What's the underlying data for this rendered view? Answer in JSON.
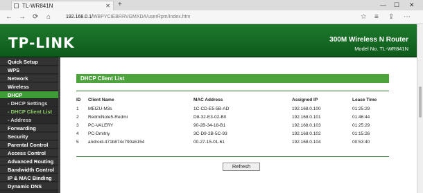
{
  "browser": {
    "tab_title": "TL-WR841N",
    "close_glyph": "✕",
    "newtab_glyph": "+",
    "url_host": "192.168.0.1/",
    "url_path": "WBPYCIEBRRVGMXDA/userRpm/Index.htm",
    "back_glyph": "←",
    "forward_glyph": "→",
    "reload_glyph": "⟳",
    "home_glyph": "⌂",
    "win_min": "—",
    "win_max": "☐",
    "win_close": "✕"
  },
  "header": {
    "logo": "TP-LINK",
    "product": "300M Wireless N Router",
    "model": "Model No. TL-WR841N"
  },
  "menu": [
    {
      "label": "Quick Setup",
      "type": "main"
    },
    {
      "label": "WPS",
      "type": "main"
    },
    {
      "label": "Network",
      "type": "main"
    },
    {
      "label": "Wireless",
      "type": "main"
    },
    {
      "label": "DHCP",
      "type": "active"
    },
    {
      "label": "- DHCP Settings",
      "type": "sub"
    },
    {
      "label": "- DHCP Client List",
      "type": "sub-selected"
    },
    {
      "label": "- Address Reservation",
      "type": "sub"
    },
    {
      "label": "Forwarding",
      "type": "main"
    },
    {
      "label": "Security",
      "type": "main"
    },
    {
      "label": "Parental Control",
      "type": "main"
    },
    {
      "label": "Access Control",
      "type": "main"
    },
    {
      "label": "Advanced Routing",
      "type": "main"
    },
    {
      "label": "Bandwidth Control",
      "type": "main"
    },
    {
      "label": "IP & MAC Binding",
      "type": "main"
    },
    {
      "label": "Dynamic DNS",
      "type": "main"
    }
  ],
  "main": {
    "section_title": "DHCP Client List",
    "columns": [
      "ID",
      "Client Name",
      "MAC Address",
      "Assigned IP",
      "Lease Time"
    ],
    "rows": [
      [
        "1",
        "MEIZU-M3s",
        "1C-CD-E5-5B-AD",
        "192.168.0.100",
        "01:25:29"
      ],
      [
        "2",
        "RedmiNote5-Redmi",
        "D8-32-E3-02-B0",
        "192.168.0.101",
        "01:46:44"
      ],
      [
        "3",
        "PC-VALERY",
        "90-2B-34-18-B1",
        "192.168.0.103",
        "01:25:29"
      ],
      [
        "4",
        "PC-Dmitriy",
        "3C-D9-2B-5C-93",
        "192.168.0.102",
        "01:15:26"
      ],
      [
        "5",
        "android-471b874c790a5154",
        "00-27-15-01-61",
        "192.168.0.104",
        "00:53:40"
      ]
    ],
    "refresh_label": "Refresh"
  }
}
